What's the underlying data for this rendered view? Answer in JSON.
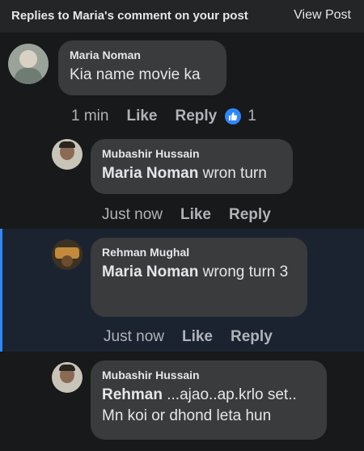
{
  "header": {
    "title": "Replies to Maria's comment on your post",
    "view_post": "View Post"
  },
  "comments": [
    {
      "name": "Maria Noman",
      "mention": "",
      "text": "Kia name movie ka",
      "time": "1 min",
      "like": "Like",
      "reply": "Reply",
      "reaction_count": "1"
    },
    {
      "name": "Mubashir Hussain",
      "mention": "Maria Noman",
      "text": " wron turn",
      "time": "Just now",
      "like": "Like",
      "reply": "Reply"
    },
    {
      "name": "Rehman Mughal",
      "mention": "Maria Noman",
      "text": " wrong turn 3",
      "time": "Just now",
      "like": "Like",
      "reply": "Reply"
    },
    {
      "name": "Mubashir Hussain",
      "mention": "Rehman",
      "text": " ...ajao..ap.krlo set.. Mn koi or dhond leta hun"
    }
  ],
  "colors": {
    "background": "#18191a",
    "bubble": "#3a3b3c",
    "accent": "#2d88ff",
    "muted_text": "#b0b3b8"
  },
  "icons": {
    "reaction": "like-reaction-icon"
  }
}
